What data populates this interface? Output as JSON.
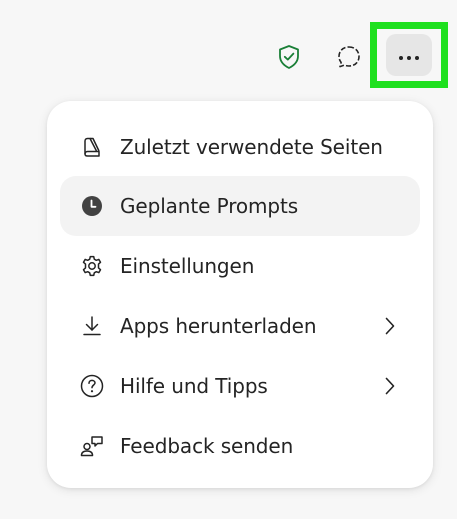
{
  "toolbar": {
    "icons": [
      "shield-check-icon",
      "chat-bubble-icon",
      "more-horizontal-icon"
    ],
    "accent_color": "#1a7f37",
    "highlight_color": "#1fe01f"
  },
  "menu": {
    "items": [
      {
        "label": "Zuletzt verwendete Seiten",
        "icon": "book-icon",
        "submenu": false,
        "active": false
      },
      {
        "label": "Geplante Prompts",
        "icon": "clock-icon",
        "submenu": false,
        "active": true
      },
      {
        "label": "Einstellungen",
        "icon": "gear-icon",
        "submenu": false,
        "active": false
      },
      {
        "label": "Apps herunterladen",
        "icon": "download-icon",
        "submenu": true,
        "active": false
      },
      {
        "label": "Hilfe und Tipps",
        "icon": "help-icon",
        "submenu": true,
        "active": false
      },
      {
        "label": "Feedback senden",
        "icon": "feedback-icon",
        "submenu": false,
        "active": false
      }
    ]
  }
}
